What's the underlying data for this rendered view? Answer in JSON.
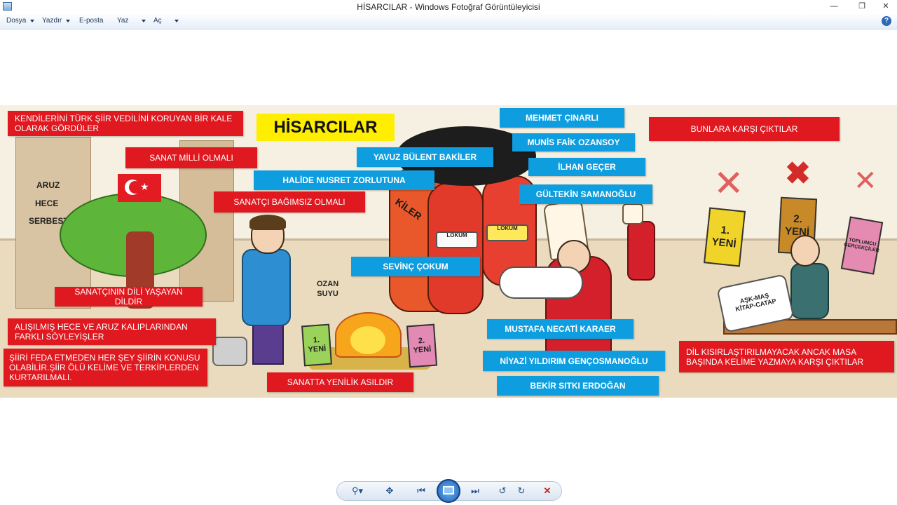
{
  "window": {
    "title": "HİSARCILAR - Windows Fotoğraf Görüntüleyicisi"
  },
  "menu": {
    "items": [
      {
        "label": "Dosya",
        "has_dropdown": true
      },
      {
        "label": "Yazdır",
        "has_dropdown": true
      },
      {
        "label": "E-posta",
        "has_dropdown": false
      },
      {
        "label": "Yaz",
        "has_dropdown": true
      },
      {
        "label": "Aç",
        "has_dropdown": true
      }
    ],
    "help_icon": "?"
  },
  "image": {
    "title": "HİSARCILAR",
    "castle_text": [
      "ARUZ",
      "HECE",
      "SERBEST"
    ],
    "ozan_suyu": [
      "OZAN",
      "SUYU"
    ],
    "kiler": "KİLER",
    "lokum": "LOKUM",
    "books": {
      "book1": [
        "1.",
        "YENİ"
      ],
      "book2": [
        "2.",
        "YENİ"
      ],
      "book3": [
        "TOPLUMCU",
        "GERÇEKÇİLER"
      ]
    },
    "scroll_text": [
      "AŞK-MAŞ",
      "KİTAP-CATAP"
    ],
    "red_labels": {
      "kale": "KENDİLERİNİ TÜRK ŞİİR VEDİLİNİ KORUYAN BİR KALE OLARAK GÖRDÜLER",
      "sanat_milli": "SANAT MİLLİ OLMALI",
      "sanatci_bagimsiz": "SANATÇI BAĞIMSIZ OLMALI",
      "dil_yasayan": "SANATÇININ DİLİ YAŞAYAN DİLDİR",
      "kaliplar": "ALIŞILMIŞ HECE VE ARUZ KALIPLARINDAN FARKLI SÖYLEYİŞLER",
      "feda": "ŞİİRİ FEDA ETMEDEN HER ŞEY ŞİİRİN KONUSU OLABİLİR.ŞİİR ÖLÜ KELİME VE TERKİPLERDEN KURTARILMALI.",
      "yenilik": "SANATTA YENİLİK ASILDIR",
      "karsi": "BUNLARA KARŞI ÇIKTILAR",
      "masa": "DİL KISIRLAŞTIRILMAYACAK ANCAK MASA BAŞINDA KELİME YAZMAYA KARŞI ÇIKTILAR"
    },
    "blue_labels": {
      "mehmet": "MEHMET ÇINARLI",
      "munis": "MUNİS FAİK OZANSOY",
      "yavuz": "YAVUZ BÜLENT BAKİLER",
      "ilhan": "İLHAN GEÇER",
      "halide": "HALİDE NUSRET ZORLUTUNA",
      "gultekin": "GÜLTEKİN SAMANOĞLU",
      "sevinc": "SEVİNÇ ÇOKUM",
      "mustafa": "MUSTAFA NECATİ KARAER",
      "niyazi": "NİYAZİ YILDIRIM GENÇOSMANOĞLU",
      "bekir": "BEKİR SITKI ERDOĞAN"
    }
  },
  "colors": {
    "red_label": "#e0181f",
    "blue_label": "#0e9ee0",
    "title_yellow": "#ffee00",
    "toolbar_accent": "#1e5fb5"
  },
  "toolbar": {
    "icons": [
      "zoom-icon",
      "actual-size-icon",
      "previous-icon",
      "slideshow-icon",
      "next-icon",
      "rotate-left-icon",
      "rotate-right-icon",
      "delete-icon"
    ]
  }
}
